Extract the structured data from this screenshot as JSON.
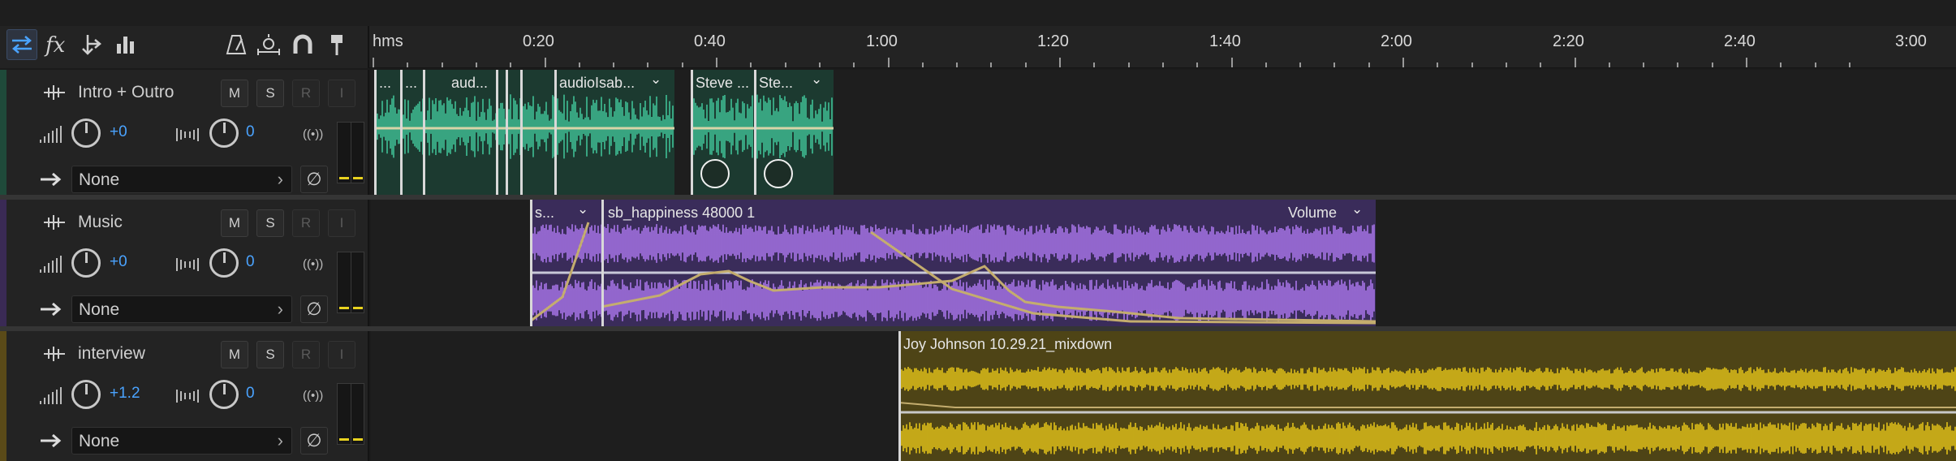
{
  "ruler": {
    "labels": [
      "hms",
      "0:20",
      "0:40",
      "1:00",
      "1:20",
      "1:40",
      "2:00",
      "2:20",
      "2:40",
      "3:00"
    ]
  },
  "toolbar": {
    "buttons": [
      "switch-view-icon",
      "effects-icon",
      "multitrack-routing-icon",
      "clip-levels-icon",
      "metronome-icon",
      "time-selection-icon",
      "snap-magnet-icon",
      "marker-icon"
    ]
  },
  "tracks": [
    {
      "name": "Intro + Outro",
      "color": "#1f4a3a",
      "volume": "+0",
      "pan": "0",
      "routing": "None",
      "mute_label": "M",
      "solo_label": "S",
      "record_label": "R",
      "input_label": "I",
      "clips": [
        {
          "title": "...",
          "color": "#1c3a30",
          "wave": "#3fbf95"
        },
        {
          "title": "...",
          "color": "#1c3a30",
          "wave": "#3fbf95"
        },
        {
          "title": "aud...",
          "color": "#1c3a30",
          "wave": "#3fbf95"
        },
        {
          "title": "audioIsab...",
          "color": "#1c3a30",
          "wave": "#3fbf95"
        },
        {
          "title": "Steve ...",
          "color": "#1c3a30",
          "wave": "#3fbf95"
        },
        {
          "title": "Ste...",
          "color": "#1c3a30",
          "wave": "#3fbf95"
        }
      ]
    },
    {
      "name": "Music",
      "color": "#3a2a55",
      "volume": "+0",
      "pan": "0",
      "routing": "None",
      "mute_label": "M",
      "solo_label": "S",
      "record_label": "R",
      "input_label": "I",
      "clips": [
        {
          "title": "s...",
          "color": "#3a2c5a",
          "wave": "#a976ea"
        },
        {
          "title": "sb_happiness 48000 1",
          "color": "#3a2c5a",
          "wave": "#a976ea",
          "param": "Volume"
        }
      ]
    },
    {
      "name": "interview",
      "color": "#5a4a18",
      "volume": "+1.2",
      "pan": "0",
      "routing": "None",
      "mute_label": "M",
      "solo_label": "S",
      "record_label": "R",
      "input_label": "I",
      "clips": [
        {
          "title": "Joy Johnson 10.29.21_mixdown",
          "color": "#4e4416",
          "wave": "#e2c21a"
        }
      ]
    }
  ]
}
